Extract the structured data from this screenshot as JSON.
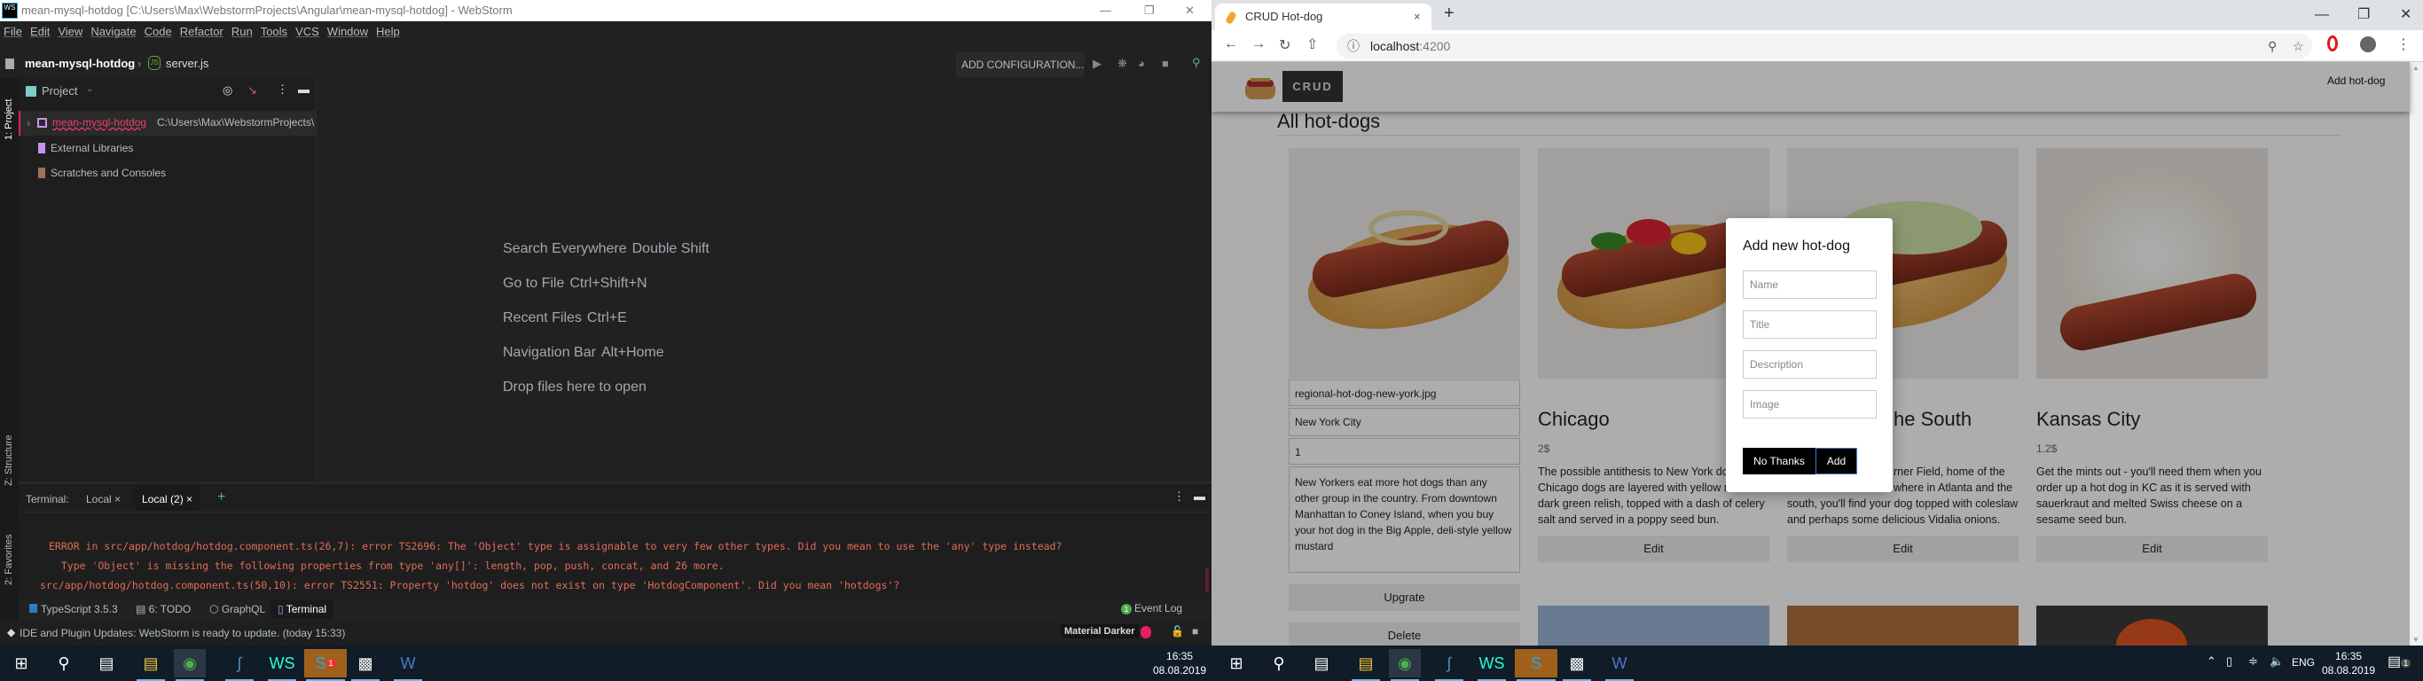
{
  "ide": {
    "window_title": "mean-mysql-hotdog [C:\\Users\\Max\\WebstormProjects\\Angular\\mean-mysql-hotdog] - WebStorm",
    "menu": [
      "File",
      "Edit",
      "View",
      "Navigate",
      "Code",
      "Refactor",
      "Run",
      "Tools",
      "VCS",
      "Window",
      "Help"
    ],
    "breadcrumb": {
      "project": "mean-mysql-hotdog",
      "file": "server.js"
    },
    "add_configuration": "ADD CONFIGURATION...",
    "left_stripe": {
      "project": "1: Project",
      "structure": "Z: Structure",
      "favorites": "2: Favorites"
    },
    "project_panel": {
      "title": "Project",
      "items": [
        {
          "label": "mean-mysql-hotdog",
          "path": "C:\\Users\\Max\\WebstormProjects\\"
        },
        {
          "label": "External Libraries"
        },
        {
          "label": "Scratches and Consoles"
        }
      ]
    },
    "welcome": [
      {
        "label": "Search Everywhere",
        "shortcut": "Double Shift"
      },
      {
        "label": "Go to File",
        "shortcut": "Ctrl+Shift+N"
      },
      {
        "label": "Recent Files",
        "shortcut": "Ctrl+E"
      },
      {
        "label": "Navigation Bar",
        "shortcut": "Alt+Home"
      },
      {
        "label": "Drop files here to open",
        "shortcut": ""
      }
    ],
    "terminal": {
      "label": "Terminal:",
      "tabs": [
        "Local",
        "Local (2)"
      ],
      "lines": [
        "ERROR in src/app/hotdog/hotdog.component.ts(26,7): error TS2696: The 'Object' type is assignable to very few other types. Did you mean to use the 'any' type instead?",
        "  Type 'Object' is missing the following properties from type 'any[]': length, pop, push, concat, and 26 more.",
        "src/app/hotdog/hotdog.component.ts(50,10): error TS2551: Property 'hotdog' does not exist on type 'HotdogComponent'. Did you mean 'hotdogs'?"
      ]
    },
    "tool_windows": [
      "TypeScript 3.5.3",
      "6: TODO",
      "GraphQL",
      "Terminal"
    ],
    "event_log": "Event Log",
    "event_count": "1",
    "status": "IDE and Plugin Updates: WebStorm is ready to update. (today 15:33)",
    "theme": "Material Darker"
  },
  "browser": {
    "tab_title": "CRUD Hot-dog",
    "url_host": "localhost",
    "url_port": ":4200",
    "page": {
      "logo_text": "CRUD",
      "add_link": "Add hot-dog",
      "heading": "All hot-dogs",
      "edit_card": {
        "image": "regional-hot-dog-new-york.jpg",
        "title": "New York City",
        "price": "1",
        "description": "New Yorkers eat more hot dogs than any other group in the country. From downtown Manhattan to Coney Island, when you buy your hot dog in the Big Apple, deli-style yellow mustard",
        "upgrade": "Upgrate",
        "delete": "Delete"
      },
      "cards": [
        {
          "title": "Chicago",
          "price": "2$",
          "desc": [
            "The possible antithesis to New York dog",
            "Chicago dogs are layered with yellow m",
            "dark green relish, topped with a dash of celery",
            "salt and served in a poppy seed bun."
          ],
          "edit": "Edit"
        },
        {
          "title": "he South",
          "price": "",
          "desc": [
            "rner Field, home of the",
            "where in Atlanta and the",
            "south, you'll find your dog topped with coleslaw",
            "and perhaps some delicious Vidalia onions."
          ],
          "edit": "Edit"
        },
        {
          "title": "Kansas City",
          "price": "1.2$",
          "desc": [
            "Get the mints out - you'll need them when you",
            "order up a hot dog in KC as it is served with",
            "sauerkraut and melted Swiss cheese on a",
            "sesame seed bun."
          ],
          "edit": "Edit"
        }
      ]
    },
    "modal": {
      "title": "Add new hot-dog",
      "placeholders": {
        "name": "Name",
        "title": "Title",
        "description": "Description",
        "image": "Image"
      },
      "no_thanks": "No Thanks",
      "add": "Add"
    }
  },
  "taskbar": {
    "time": "16:35",
    "date": "08.08.2019",
    "lang": "ENG",
    "notifications": "1",
    "skype_badge": "1"
  },
  "colors": {
    "ide_bg": "#212121",
    "error": "#e06c5a",
    "accent": "#e91e63",
    "chrome_tab": "#dee1e6"
  }
}
